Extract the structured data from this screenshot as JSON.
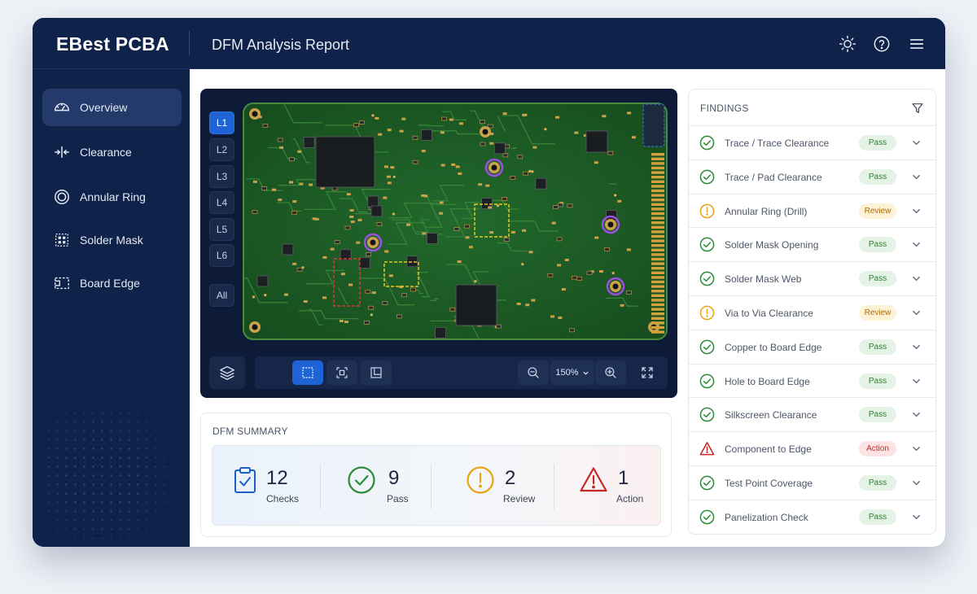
{
  "header": {
    "brand": "EBest PCBA",
    "title": "DFM Analysis Report",
    "icons": [
      "sun-icon",
      "help-icon",
      "menu-icon"
    ]
  },
  "sidebar": {
    "items": [
      {
        "label": "Overview",
        "icon": "gauge-icon",
        "active": true
      },
      {
        "label": "Clearance",
        "icon": "clearance-icon"
      },
      {
        "label": "Annular Ring",
        "icon": "ring-icon"
      },
      {
        "label": "Solder Mask",
        "icon": "solder-mask-icon"
      },
      {
        "label": "Board Edge",
        "icon": "board-edge-icon"
      }
    ]
  },
  "viewer": {
    "layers": [
      "L1",
      "L2",
      "L3",
      "L4",
      "L5",
      "L6",
      "All"
    ],
    "active_layer": "L1",
    "zoom": "150%"
  },
  "summary": {
    "title": "DFM SUMMARY",
    "stats": [
      {
        "value": "12",
        "label": "Checks",
        "color": "#1e5fc7"
      },
      {
        "value": "9",
        "label": "Pass",
        "color": "#2e8b3a"
      },
      {
        "value": "2",
        "label": "Review",
        "color": "#e8a317"
      },
      {
        "value": "1",
        "label": "Action",
        "color": "#c62828"
      }
    ]
  },
  "findings": {
    "title": "FINDINGS",
    "items": [
      {
        "name": "Trace / Trace Clearance",
        "status": "Pass"
      },
      {
        "name": "Trace / Pad Clearance",
        "status": "Pass"
      },
      {
        "name": "Annular Ring (Drill)",
        "status": "Review"
      },
      {
        "name": "Solder Mask Opening",
        "status": "Pass"
      },
      {
        "name": "Solder Mask Web",
        "status": "Pass"
      },
      {
        "name": "Via to Via Clearance",
        "status": "Review"
      },
      {
        "name": "Copper to Board Edge",
        "status": "Pass"
      },
      {
        "name": "Hole to Board Edge",
        "status": "Pass"
      },
      {
        "name": "Silkscreen Clearance",
        "status": "Pass"
      },
      {
        "name": "Component to Edge",
        "status": "Action"
      },
      {
        "name": "Test Point Coverage",
        "status": "Pass"
      },
      {
        "name": "Panelization Check",
        "status": "Pass"
      }
    ]
  },
  "colors": {
    "navy": "#0f2249",
    "accent": "#1f64d6",
    "pass": "#2e8b3a",
    "review": "#e8a317",
    "action": "#c62828",
    "pcb_green": "#1c5a24"
  }
}
